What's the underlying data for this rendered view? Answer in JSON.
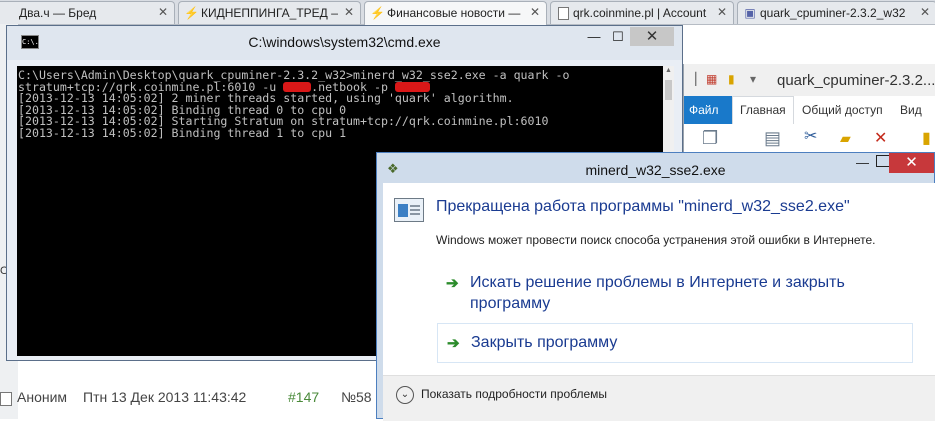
{
  "browser": {
    "tabs": [
      {
        "label": "Два.ч — Бред",
        "icon": "",
        "active": false
      },
      {
        "label": "КИДНЕППИНГА_ТРЕД — Бред",
        "icon": "⚡",
        "active": false
      },
      {
        "label": "Финансовые новости — Бред",
        "icon": "⚡",
        "active": true
      },
      {
        "label": "qrk.coinmine.pl | Account",
        "icon": "",
        "active": false
      },
      {
        "label": "quark_cpuminer-2.3.2_w32",
        "icon": "",
        "active": false
      }
    ]
  },
  "page": {
    "side_fragment": "О",
    "post": {
      "author": "Аноним",
      "date": "Птн 13 Дек 2013 11:43:42",
      "post_num": "#147",
      "id_fragment": "№58"
    }
  },
  "explorer": {
    "title": "quark_cpuminer-2.3.2...",
    "ribbon_tabs": [
      "Файл",
      "Главная",
      "Общий доступ",
      "Вид"
    ]
  },
  "cmd": {
    "title": "C:\\windows\\system32\\cmd.exe",
    "icon_label": "C:\\.",
    "min_label": "—",
    "max_label": "☐",
    "close_label": "✕",
    "lines": [
      {
        "a": "C:\\Users\\Admin\\Desktop\\quark_cpuminer-2.3.2_w32>minerd_w32_sse2.exe -a quark -o",
        "r1": "",
        "b": "",
        "r2": "",
        "c": ""
      },
      {
        "a": "stratum+tcp://qrk.coinmine.pl:6010 -u ",
        "r1": "xxxx",
        "b": ".netbook -p ",
        "r2": "xxxxx",
        "c": ""
      },
      {
        "a": "[2013-12-13 14:05:02] 2 miner threads started, using 'quark' algorithm.",
        "r1": "",
        "b": "",
        "r2": "",
        "c": ""
      },
      {
        "a": "[2013-12-13 14:05:02] Binding thread 0 to cpu 0",
        "r1": "",
        "b": "",
        "r2": "",
        "c": ""
      },
      {
        "a": "[2013-12-13 14:05:02] Starting Stratum on stratum+tcp://qrk.coinmine.pl:6010",
        "r1": "",
        "b": "",
        "r2": "",
        "c": ""
      },
      {
        "a": "[2013-12-13 14:05:02] Binding thread 1 to cpu 1",
        "r1": "",
        "b": "",
        "r2": "",
        "c": ""
      }
    ]
  },
  "dialog": {
    "title": "minerd_w32_sse2.exe",
    "headline": "Прекращена работа программы \"minerd_w32_sse2.exe\"",
    "subline": "Windows может провести поиск способа устранения этой ошибки в Интернете.",
    "option_search": "Искать решение проблемы в Интернете и закрыть программу",
    "option_close": "Закрыть программу",
    "details": "Показать подробности проблемы",
    "min_label": "—",
    "close_label": "✕"
  }
}
